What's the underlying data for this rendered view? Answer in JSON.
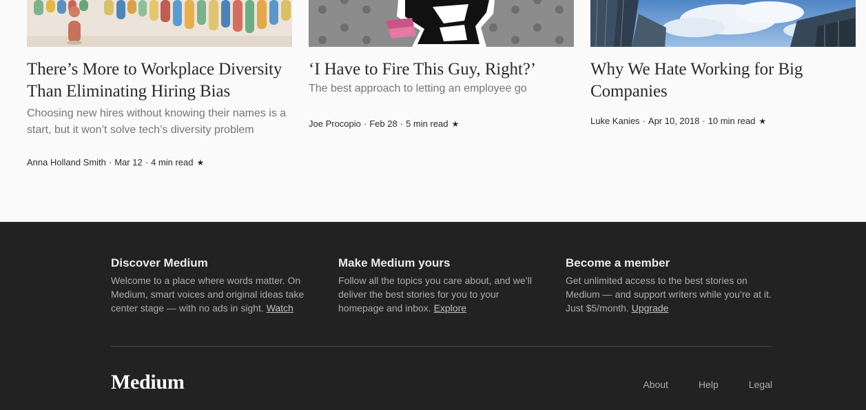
{
  "cards": [
    {
      "title": "There’s More to Workplace Diversity Than Eliminating Hiring Bias",
      "subtitle": "Choosing new hires without knowing their names is a start, but it won’t solve tech’s diversity problem",
      "author": "Anna Holland Smith",
      "date": "Mar 12",
      "read_time": "4 min read",
      "star": "★"
    },
    {
      "title": "‘I Have to Fire This Guy, Right?’",
      "subtitle": "The best approach to letting an employee go",
      "author": "Joe Procopio",
      "date": "Feb 28",
      "read_time": "5 min read",
      "star": "★"
    },
    {
      "title": "Why We Hate Working for Big Companies",
      "subtitle": "",
      "author": "Luke Kanies",
      "date": "Apr 10, 2018",
      "read_time": "10 min read",
      "star": "★"
    }
  ],
  "separator": "·",
  "footer": {
    "promos": [
      {
        "title": "Discover Medium",
        "text": "Welcome to a place where words matter. On Medium, smart voices and original ideas take center stage — with no ads in sight.",
        "link": "Watch"
      },
      {
        "title": "Make Medium yours",
        "text": "Follow all the topics you care about, and we’ll deliver the best stories for you to your homepage and inbox.",
        "link": "Explore"
      },
      {
        "title": "Become a member",
        "text": "Get unlimited access to the best stories on Medium — and support writers while you’re at it. Just $5/month.",
        "link": "Upgrade"
      }
    ],
    "logo": "Medium",
    "links": [
      "About",
      "Help",
      "Legal"
    ]
  },
  "colors": {
    "page_bg": "#fafafa",
    "footer_bg": "#222222",
    "divider": "#4a4a4a"
  }
}
